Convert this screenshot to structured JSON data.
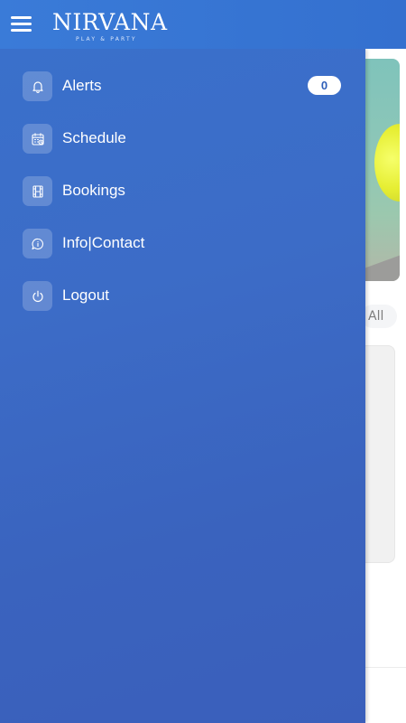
{
  "header": {
    "brand_name": "NIRVANA",
    "brand_tagline": "PLAY & PARTY",
    "menu_icon": "hamburger-menu-icon"
  },
  "colors": {
    "appbar": "#3a7bd8",
    "drawer": "#3a66c2",
    "badge_bg": "#ffffff",
    "badge_text": "#2f5fb9"
  },
  "drawer": {
    "items": [
      {
        "label": "Alerts",
        "icon": "bell-icon",
        "badge": "0"
      },
      {
        "label": "Schedule",
        "icon": "calendar-icon"
      },
      {
        "label": "Bookings",
        "icon": "film-strip-icon"
      },
      {
        "label": "Info|Contact",
        "icon": "chat-info-icon"
      },
      {
        "label": "Logout",
        "icon": "power-icon"
      }
    ]
  },
  "background": {
    "filter_chip": "All"
  }
}
